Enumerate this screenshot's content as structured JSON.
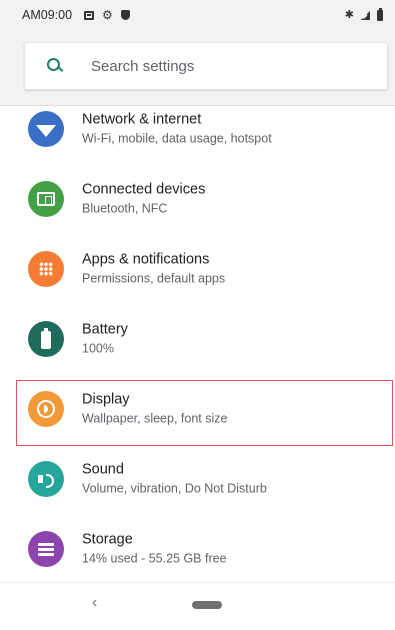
{
  "status_bar": {
    "time": "AM09:00",
    "left_icons": [
      "sd-card-icon",
      "gear-icon",
      "shield-icon"
    ],
    "right_icons": [
      "bluetooth-icon",
      "signal-icon",
      "battery-icon"
    ]
  },
  "search": {
    "placeholder": "Search settings",
    "icon": "search-icon",
    "accent_color": "#1a7f6e"
  },
  "settings_items": [
    {
      "title": "Network & internet",
      "subtitle": "Wi-Fi, mobile, data usage, hotspot",
      "icon": "wifi-icon",
      "icon_color": "#3b6fc6"
    },
    {
      "title": "Connected devices",
      "subtitle": "Bluetooth, NFC",
      "icon": "devices-icon",
      "icon_color": "#43a047"
    },
    {
      "title": "Apps & notifications",
      "subtitle": "Permissions, default apps",
      "icon": "apps-icon",
      "icon_color": "#f57c32"
    },
    {
      "title": "Battery",
      "subtitle": "100%",
      "icon": "battery-icon",
      "icon_color": "#1f6b5c"
    },
    {
      "title": "Display",
      "subtitle": "Wallpaper, sleep, font size",
      "icon": "brightness-icon",
      "icon_color": "#f29a3a",
      "highlighted": true,
      "highlight_color": "#d9545c"
    },
    {
      "title": "Sound",
      "subtitle": "Volume, vibration, Do Not Disturb",
      "icon": "volume-icon",
      "icon_color": "#26a69a"
    },
    {
      "title": "Storage",
      "subtitle": "14% used - 55.25 GB free",
      "icon": "storage-icon",
      "icon_color": "#8e44ad"
    }
  ],
  "nav_bar": {
    "back_glyph": "‹",
    "back_icon": "back-icon",
    "home_icon": "home-pill-icon"
  }
}
